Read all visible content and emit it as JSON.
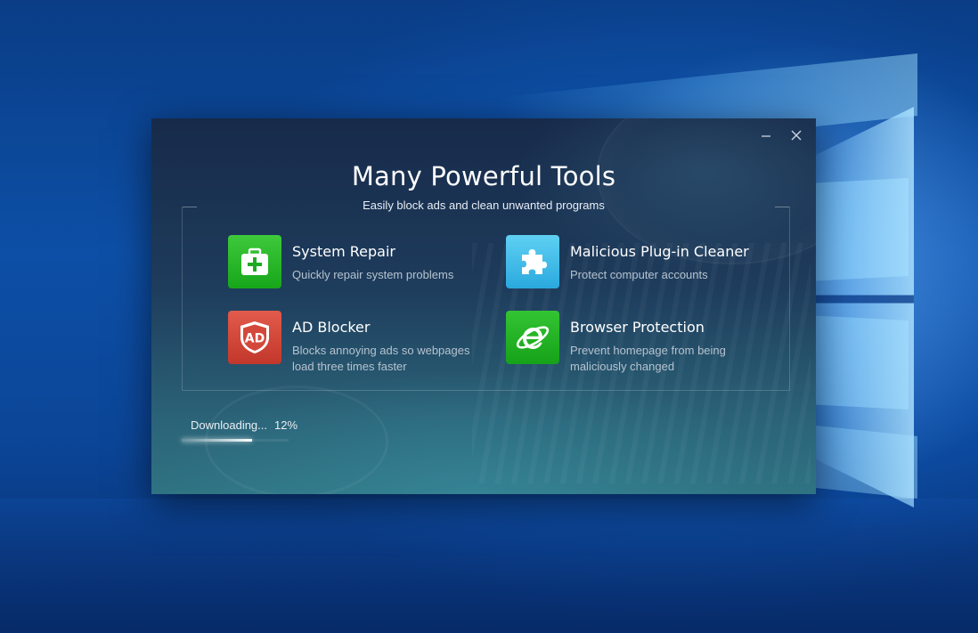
{
  "dialog": {
    "title": "Many Powerful Tools",
    "subtitle": "Easily block ads and clean unwanted programs",
    "features": [
      {
        "title": "System Repair",
        "description": "Quickly repair system problems",
        "icon": "first-aid-kit-icon",
        "color": "#22b024"
      },
      {
        "title": "Malicious Plug-in Cleaner",
        "description": "Protect computer accounts",
        "icon": "puzzle-piece-icon",
        "color": "#3fbbe8"
      },
      {
        "title": "AD Blocker",
        "description": "Blocks annoying ads so webpages load three times faster",
        "icon": "ad-shield-icon",
        "icon_text": "AD",
        "color": "#d2463a"
      },
      {
        "title": "Browser Protection",
        "description": "Prevent homepage from being maliciously changed",
        "icon": "internet-explorer-icon",
        "color": "#22b024"
      }
    ],
    "progress": {
      "label": "Downloading...",
      "percent_text": "12%",
      "value": 0.12
    },
    "controls": {
      "minimize_icon": "minimize-icon",
      "close_icon": "close-icon"
    }
  }
}
